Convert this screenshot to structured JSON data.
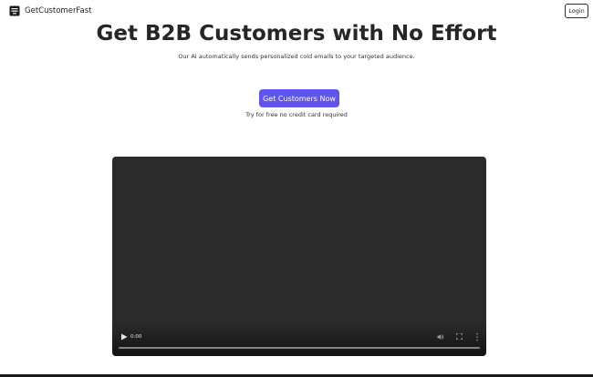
{
  "header": {
    "brand_name": "GetCustomerFast",
    "brand_icon": "server-stack-icon",
    "login_label": "Login"
  },
  "hero": {
    "title": "Get B2B Customers with No Effort",
    "subtitle": "Our AI automatically sends personalized cold emails to your targeted audience.",
    "cta_label": "Get Customers Now",
    "cta_note": "Try for free no credit card required"
  },
  "video": {
    "time": "0:00",
    "progress": 0,
    "icons": {
      "play": "play-icon",
      "volume": "volume-icon",
      "fullscreen": "fullscreen-icon",
      "more": "more-vertical-icon"
    }
  },
  "colors": {
    "accent": "#6054f0",
    "video_background": "#2c2c2c",
    "text": "#262626"
  }
}
